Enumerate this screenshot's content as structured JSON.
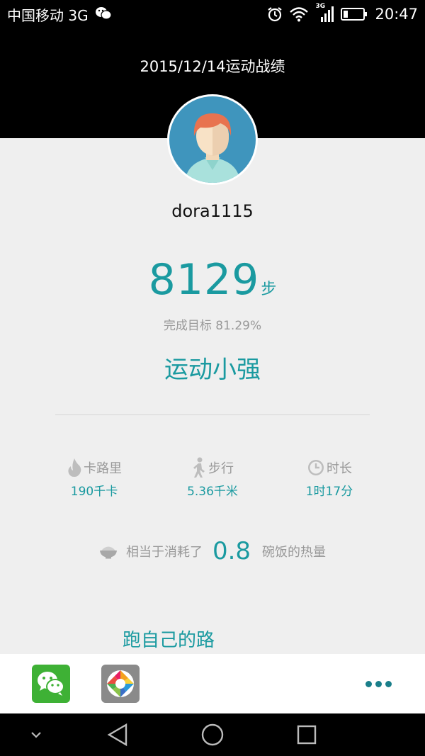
{
  "status_bar": {
    "carrier": "中国移动 3G",
    "network": "3G",
    "time": "20:47"
  },
  "header": {
    "title": "2015/12/14运动战绩"
  },
  "profile": {
    "username": "dora1115"
  },
  "steps": {
    "count": "8129",
    "unit": "步",
    "goal_text": "完成目标 81.29%",
    "rank_title": "运动小强"
  },
  "stats": [
    {
      "icon": "flame-icon",
      "label": "卡路里",
      "value": "190千卡"
    },
    {
      "icon": "walking-icon",
      "label": "步行",
      "value": "5.36千米"
    },
    {
      "icon": "clock-icon",
      "label": "时长",
      "value": "1时17分"
    }
  ],
  "equivalent": {
    "prefix": "相当于消耗了",
    "value": "0.8",
    "suffix": "碗饭的热量"
  },
  "slogan": {
    "line1": "跑自己的路"
  },
  "colors": {
    "accent": "#1a9aa0",
    "background": "#efefef",
    "wechat_green": "#3eb135"
  }
}
